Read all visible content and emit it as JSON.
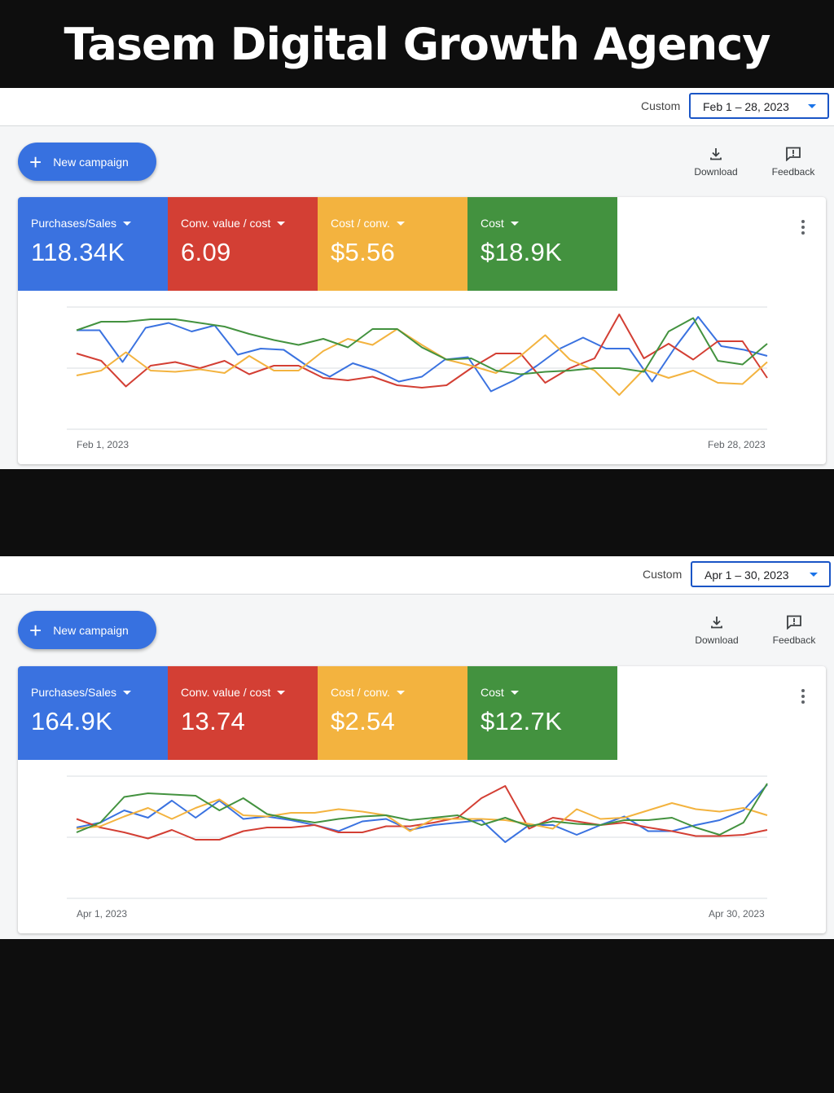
{
  "banner": {
    "title": "Tasem Digital Growth Agency"
  },
  "panels": [
    {
      "custom_label": "Custom",
      "date_range": "Feb 1 – 28, 2023",
      "new_campaign_label": "New campaign",
      "download_label": "Download",
      "feedback_label": "Feedback",
      "metrics": [
        {
          "name": "Purchases/Sales",
          "value": "118.34K",
          "color": "#3a72e0"
        },
        {
          "name": "Conv. value / cost",
          "value": "6.09",
          "color": "#d33f34"
        },
        {
          "name": "Cost / conv.",
          "value": "$5.56",
          "color": "#f3b33f"
        },
        {
          "name": "Cost",
          "value": "$18.9K",
          "color": "#43923f"
        }
      ],
      "chart_data": {
        "type": "line",
        "x_start_label": "Feb 1, 2023",
        "x_end_label": "Feb 28, 2023",
        "ylim": [
          0,
          100
        ],
        "series": [
          {
            "color": "#3a72e0",
            "values": [
              81,
              81,
              55,
              83,
              87,
              80,
              85,
              61,
              66,
              65,
              52,
              43,
              54,
              48,
              39,
              43,
              57,
              59,
              31,
              40,
              52,
              66,
              75,
              66,
              66,
              39,
              67,
              92,
              68,
              65,
              60
            ]
          },
          {
            "color": "#d33f34",
            "values": [
              62,
              56,
              35,
              52,
              55,
              50,
              56,
              45,
              52,
              52,
              42,
              40,
              43,
              36,
              34,
              36,
              50,
              62,
              62,
              38,
              50,
              58,
              94,
              58,
              70,
              57,
              72,
              72,
              42
            ]
          },
          {
            "color": "#f3b33f",
            "values": [
              44,
              48,
              63,
              48,
              47,
              49,
              46,
              60,
              48,
              48,
              64,
              74,
              69,
              82,
              69,
              57,
              52,
              46,
              60,
              77,
              57,
              48,
              28,
              49,
              42,
              48,
              38,
              37,
              55
            ]
          },
          {
            "color": "#43923f",
            "values": [
              81,
              88,
              88,
              90,
              90,
              87,
              84,
              78,
              73,
              69,
              74,
              67,
              82,
              82,
              67,
              57,
              58,
              48,
              45,
              47,
              48,
              50,
              50,
              47,
              80,
              91,
              56,
              53,
              70
            ]
          }
        ]
      }
    },
    {
      "custom_label": "Custom",
      "date_range": "Apr 1 – 30, 2023",
      "new_campaign_label": "New campaign",
      "download_label": "Download",
      "feedback_label": "Feedback",
      "metrics": [
        {
          "name": "Purchases/Sales",
          "value": "164.9K",
          "color": "#3a72e0"
        },
        {
          "name": "Conv. value / cost",
          "value": "13.74",
          "color": "#d33f34"
        },
        {
          "name": "Cost / conv.",
          "value": "$2.54",
          "color": "#f3b33f"
        },
        {
          "name": "Cost",
          "value": "$12.7K",
          "color": "#43923f"
        }
      ],
      "chart_data": {
        "type": "line",
        "x_start_label": "Apr 1, 2023",
        "x_end_label": "Apr 30, 2023",
        "ylim": [
          0,
          100
        ],
        "series": [
          {
            "color": "#3a72e0",
            "values": [
              58,
              62,
              72,
              66,
              80,
              66,
              80,
              65,
              67,
              64,
              60,
              55,
              63,
              65,
              56,
              60,
              62,
              64,
              46,
              60,
              60,
              52,
              60,
              67,
              55,
              55,
              60,
              64,
              72,
              93
            ]
          },
          {
            "color": "#d33f34",
            "values": [
              65,
              58,
              54,
              49,
              56,
              48,
              48,
              55,
              58,
              58,
              60,
              54,
              54,
              59,
              59,
              62,
              66,
              82,
              92,
              57,
              66,
              63,
              60,
              62,
              58,
              55,
              51,
              51,
              52,
              56
            ]
          },
          {
            "color": "#f3b33f",
            "values": [
              57,
              59,
              67,
              74,
              65,
              74,
              81,
              68,
              67,
              70,
              70,
              73,
              71,
              68,
              55,
              65,
              65,
              65,
              64,
              61,
              57,
              73,
              65,
              66,
              72,
              78,
              73,
              71,
              74,
              68
            ]
          },
          {
            "color": "#43923f",
            "values": [
              54,
              62,
              83,
              86,
              85,
              84,
              72,
              82,
              69,
              65,
              62,
              65,
              67,
              68,
              64,
              66,
              68,
              60,
              66,
              59,
              63,
              61,
              60,
              64,
              64,
              66,
              58,
              52,
              62,
              94
            ]
          }
        ]
      }
    }
  ]
}
